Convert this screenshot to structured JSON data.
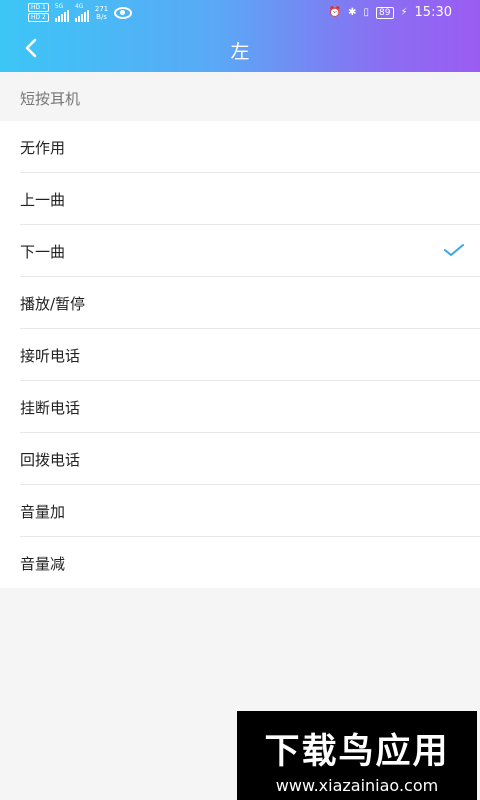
{
  "status_bar": {
    "hd1": "HD 1",
    "hd2": "HD 2",
    "net_5g": "5G",
    "net_4g": "4G",
    "speed_value": "271",
    "speed_unit": "B/s",
    "battery": "89",
    "time": "15:30"
  },
  "header": {
    "title": "左"
  },
  "section": {
    "label": "短按耳机"
  },
  "options": [
    {
      "label": "无作用",
      "selected": false
    },
    {
      "label": "上一曲",
      "selected": false
    },
    {
      "label": "下一曲",
      "selected": true
    },
    {
      "label": "播放/暂停",
      "selected": false
    },
    {
      "label": "接听电话",
      "selected": false
    },
    {
      "label": "挂断电话",
      "selected": false
    },
    {
      "label": "回拨电话",
      "selected": false
    },
    {
      "label": "音量加",
      "selected": false
    },
    {
      "label": "音量减",
      "selected": false
    }
  ],
  "watermark": {
    "title": "下载鸟应用",
    "url": "www.xiazainiao.com"
  },
  "colors": {
    "header_start": "#3cc6f6",
    "header_end": "#9b5cf3",
    "check": "#3aa8e8"
  }
}
